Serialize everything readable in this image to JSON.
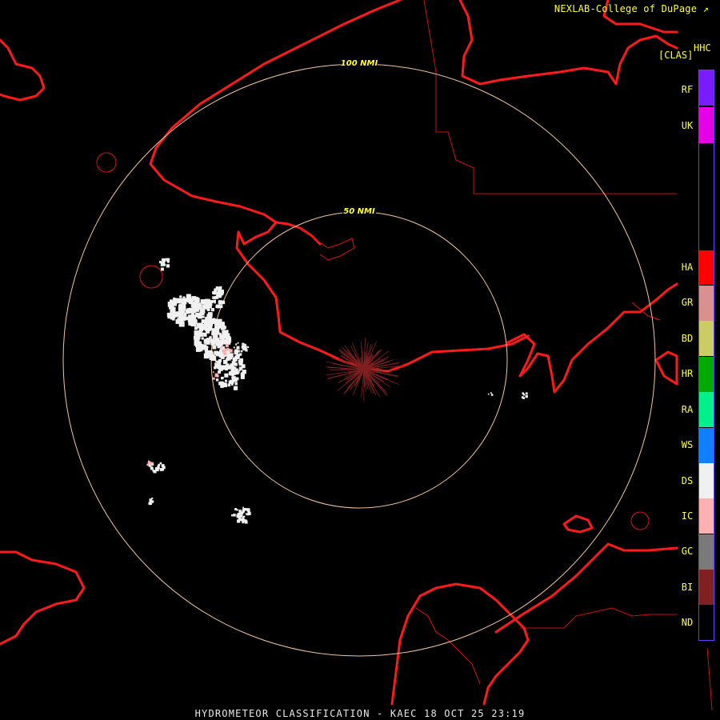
{
  "header": {
    "credit": "NEXLAB-College of DuPage",
    "credit_icon": "external-link-icon",
    "product_code": "HHC",
    "mode_label": "[CLAS]"
  },
  "range_rings": [
    {
      "label": "100 NMI"
    },
    {
      "label": "50 NMI"
    }
  ],
  "legend": {
    "border_color": "#6b3cff",
    "classes": [
      {
        "code": "RF",
        "color": "#7a1cff"
      },
      {
        "code": "UK",
        "color": "#e600e6"
      },
      {
        "code": "HA",
        "color": "#ff0000"
      },
      {
        "code": "GR",
        "color": "#d9908f"
      },
      {
        "code": "BD",
        "color": "#cccc66"
      },
      {
        "code": "HR",
        "color": "#00aa00"
      },
      {
        "code": "RA",
        "color": "#00f08c"
      },
      {
        "code": "WS",
        "color": "#0f80ff"
      },
      {
        "code": "DS",
        "color": "#f0f0f0"
      },
      {
        "code": "IC",
        "color": "#ffb0b0"
      },
      {
        "code": "GC",
        "color": "#7a7a7a"
      },
      {
        "code": "BI",
        "color": "#802020"
      },
      {
        "code": "ND",
        "color": "#000000"
      }
    ]
  },
  "footer": {
    "text": "HYDROMETEOR CLASSIFICATION - KAEC 18 OCT 25 23:19"
  },
  "colors": {
    "coastline": "#ff1a1a",
    "borders": "#cc1111",
    "range_ring": "#f4c6a0",
    "snow_echo": "#f0f0f0",
    "ice_crystal_echo": "#ffb0b0",
    "biological_echo": "#802020"
  }
}
